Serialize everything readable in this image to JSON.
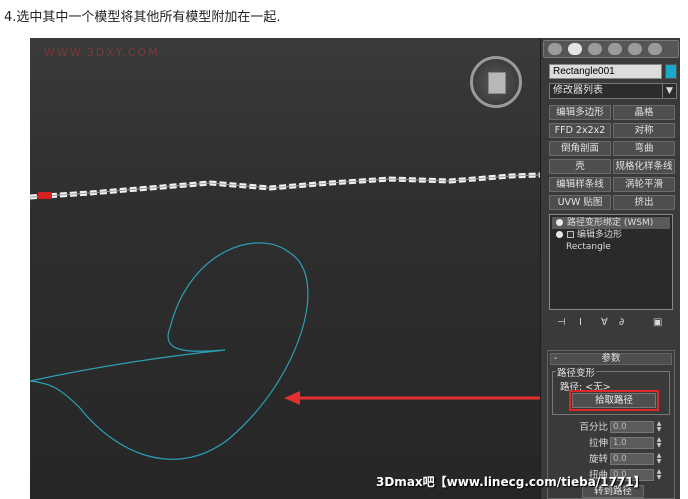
{
  "caption": "4.选中其中一个模型将其他所有模型附加在一起.",
  "viewport": {
    "watermark": "WWW.3DXY.COM"
  },
  "panel": {
    "object_name": "Rectangle001",
    "object_color": "#19a8c8",
    "modifier_list": "修改器列表",
    "modifier_buttons": [
      [
        "编辑多边形",
        "晶格"
      ],
      [
        "FFD 2x2x2",
        "对称"
      ],
      [
        "倒角剖面",
        "弯曲"
      ],
      [
        "壳",
        "规格化样条线"
      ],
      [
        "编辑样条线",
        "涡轮平滑"
      ],
      [
        "UVW 贴图",
        "挤出"
      ]
    ],
    "stack": [
      "路径变形绑定 (WSM)",
      "编辑多边形",
      "Rectangle"
    ],
    "params": {
      "minus": "-",
      "title": "参数",
      "group_label": "路径变形",
      "path_label": "路径: <无>",
      "pick_path": "拾取路径",
      "spinners": [
        {
          "label": "百分比",
          "value": "0.0"
        },
        {
          "label": "拉伸",
          "value": "1.0"
        },
        {
          "label": "旋转",
          "value": "0.0"
        },
        {
          "label": "扭曲",
          "value": "0.0"
        }
      ],
      "bottom_button": "转到路径"
    }
  },
  "bottom_watermark": "3Dmax吧【www.linecg.com/tieba/1771】",
  "colors": {
    "arrow": "#e03030",
    "curve": "#2aa0b8",
    "chain": "#f2f2f2"
  }
}
